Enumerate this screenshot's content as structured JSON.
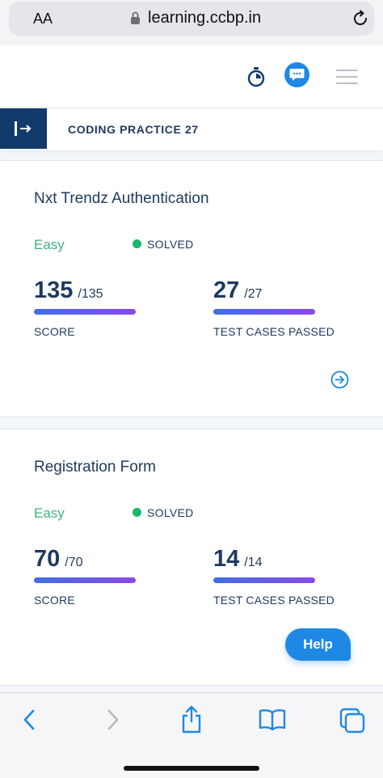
{
  "browser": {
    "aa_label": "AA",
    "url": "learning.ccbp.in"
  },
  "practice": {
    "title": "CODING PRACTICE 27"
  },
  "cards": [
    {
      "title": "Nxt Trendz Authentication",
      "difficulty": "Easy",
      "status": "SOLVED",
      "score": {
        "value": "135",
        "total": "/135",
        "label": "SCORE"
      },
      "tests": {
        "value": "27",
        "total": "/27",
        "label": "TEST CASES PASSED"
      }
    },
    {
      "title": "Registration Form",
      "difficulty": "Easy",
      "status": "SOLVED",
      "score": {
        "value": "70",
        "total": "/70",
        "label": "SCORE"
      },
      "tests": {
        "value": "14",
        "total": "/14",
        "label": "TEST CASES PASSED"
      }
    }
  ],
  "help": {
    "label": "Help"
  },
  "colors": {
    "accent": "#1e88e5",
    "navy": "#123b6b",
    "easy": "#3fb27f",
    "solved": "#18b86a"
  },
  "icons": [
    "lock-icon",
    "reload-icon",
    "timer-icon",
    "chat-icon",
    "menu-icon",
    "sidebar-toggle-icon",
    "arrow-right-circle-icon",
    "back-icon",
    "forward-icon",
    "share-icon",
    "bookmarks-icon",
    "tabs-icon"
  ]
}
